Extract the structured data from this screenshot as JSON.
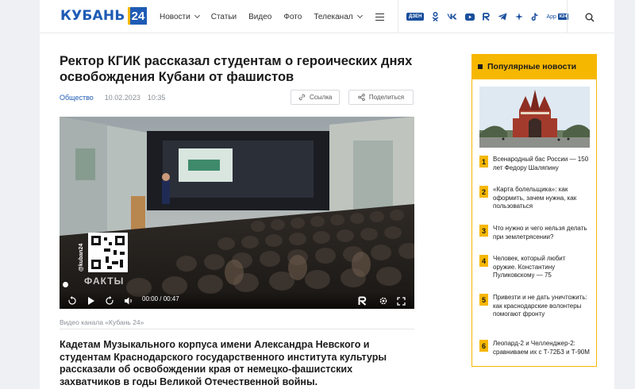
{
  "header": {
    "logo_text": "КУБАНЬ",
    "logo_number": "24",
    "nav": [
      {
        "label": "Новости",
        "dropdown": true
      },
      {
        "label": "Статьи",
        "dropdown": false
      },
      {
        "label": "Видео",
        "dropdown": false
      },
      {
        "label": "Фото",
        "dropdown": false
      },
      {
        "label": "Телеканал",
        "dropdown": true
      }
    ],
    "socials": [
      "dzen-icon",
      "odnoklassniki-icon",
      "vk-icon",
      "youtube-icon",
      "rutube-icon",
      "telegram-icon",
      "star-icon",
      "tiktok-icon"
    ],
    "dzen_label": "ДЗЕН",
    "app_label": "App",
    "app_badge": "К24"
  },
  "article": {
    "title": "Ректор КГИК рассказал студентам о героических днях освобождения Кубани от фашистов",
    "category": "Общество",
    "date": "10.02.2023",
    "time": "10:35",
    "link_button": "Ссылка",
    "share_button": "Поделиться",
    "video": {
      "watermark": "ФАКТЫ",
      "channel_tag": "@kuban24",
      "time_display": "00:00 / 00:47",
      "progress": 0
    },
    "caption": "Видео канала «Кубань 24»",
    "lead": "Кадетам Музыкального корпуса имени Александра Невского и студентам Краснодарского государственного института культуры рассказали об освобождении края от немецко-фашистских захватчиков в годы Великой Отечественной войны."
  },
  "sidebar": {
    "title": "Популярные новости",
    "items": [
      {
        "num": "1",
        "text": "Всенародный бас России — 150 лет Федору Шаляпину"
      },
      {
        "num": "2",
        "text": "«Карта болельщика»: как оформить, зачем нужна, как пользоваться"
      },
      {
        "num": "3",
        "text": "Что нужно и чего нельзя делать при землетрясении?"
      },
      {
        "num": "4",
        "text": "Человек, который любит оружие. Константину Пуликовскому — 75"
      },
      {
        "num": "5",
        "text": "Привезти и не дать уничтожить: как краснодарские волонтеры помогают фронту"
      },
      {
        "num": "6",
        "text": "Леопард-2 и Челленджер-2: сравниваем их с Т-72Б3 и Т-90М"
      }
    ]
  },
  "colors": {
    "brand_blue": "#1e5bb5",
    "accent_yellow": "#f6b700"
  }
}
